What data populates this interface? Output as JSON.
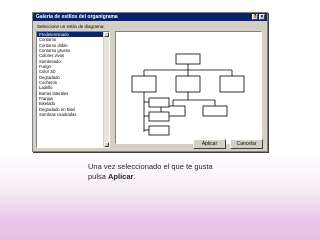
{
  "dialog": {
    "title": "Galería de estilos del organigrama",
    "prompt": "Seleccione un estilo de diagrama:",
    "styles": [
      "Predeterminado",
      "Contorno",
      "Contorno doble",
      "Contorno grueso",
      "Colores vivos",
      "Sombreado",
      "Fuego",
      "Color 3D",
      "Degradado",
      "Cocheros",
      "Ladrillo",
      "Barras laterales",
      "Franjas",
      "Biselado",
      "Degradado en bisel",
      "Sombras cuadradas"
    ],
    "selected_index": 0,
    "apply_label": "Aplicar",
    "cancel_label": "Cancelar"
  },
  "caption": {
    "text_before": "Una vez seleccionado el que te gusta",
    "text_pulsa": "pulsa ",
    "apply_word": "Aplicar",
    "period": "."
  }
}
